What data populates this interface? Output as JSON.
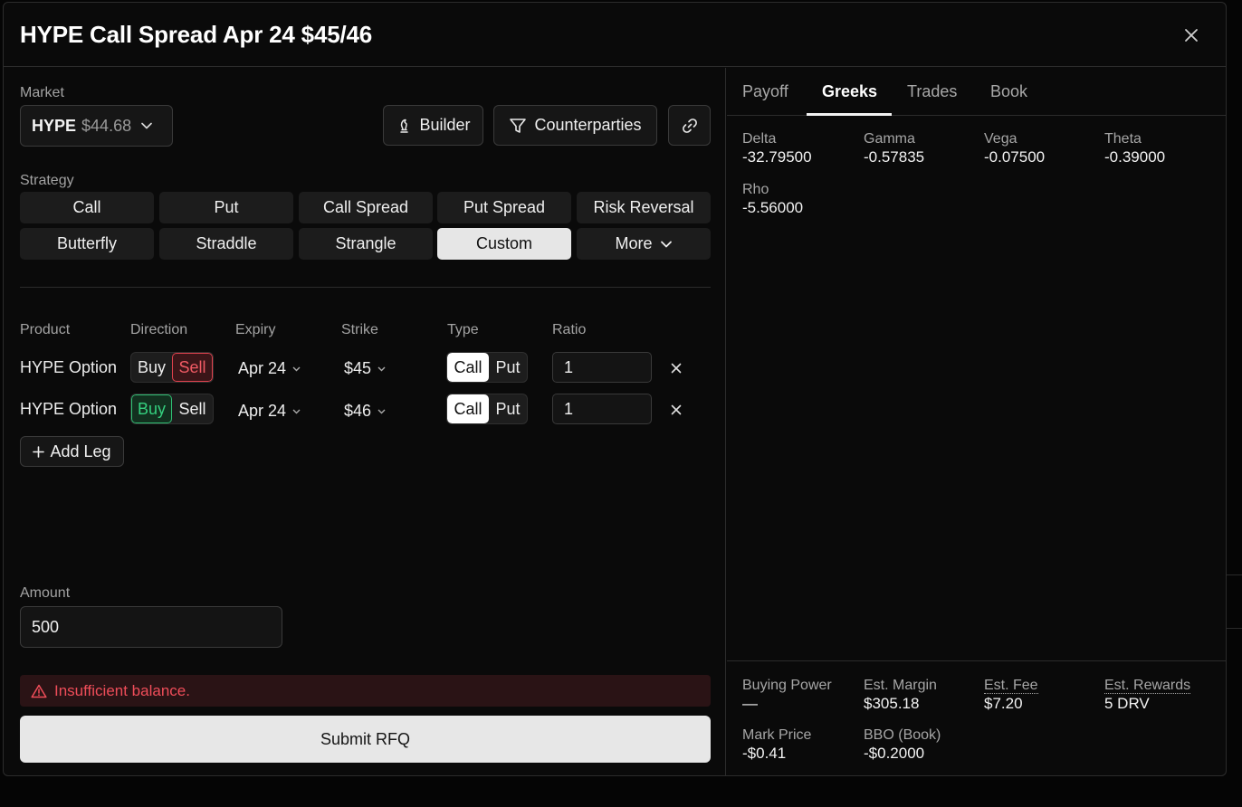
{
  "title": "HYPE Call Spread Apr 24 $45/46",
  "market": {
    "label": "Market",
    "symbol": "HYPE",
    "price": "$44.68"
  },
  "toolbar": {
    "builder": "Builder",
    "counterparties": "Counterparties"
  },
  "strategy": {
    "label": "Strategy",
    "row1": [
      "Call",
      "Put",
      "Call Spread",
      "Put Spread",
      "Risk Reversal"
    ],
    "row2": [
      "Butterfly",
      "Straddle",
      "Strangle",
      "Custom",
      "More"
    ],
    "active": "Custom"
  },
  "legs_header": {
    "product": "Product",
    "direction": "Direction",
    "expiry": "Expiry",
    "strike": "Strike",
    "type": "Type",
    "ratio": "Ratio"
  },
  "legs": [
    {
      "product": "HYPE Option",
      "buy": "Buy",
      "sell": "Sell",
      "direction": "Sell",
      "expiry": "Apr 24",
      "strike": "$45",
      "call": "Call",
      "put": "Put",
      "type": "Call",
      "ratio": "1"
    },
    {
      "product": "HYPE Option",
      "buy": "Buy",
      "sell": "Sell",
      "direction": "Buy",
      "expiry": "Apr 24",
      "strike": "$46",
      "call": "Call",
      "put": "Put",
      "type": "Call",
      "ratio": "1"
    }
  ],
  "add_leg": "Add Leg",
  "amount": {
    "label": "Amount",
    "value": "500"
  },
  "error": "Insufficient balance.",
  "submit": "Submit RFQ",
  "tabs": [
    "Payoff",
    "Greeks",
    "Trades",
    "Book"
  ],
  "active_tab": "Greeks",
  "greeks": [
    {
      "name": "Delta",
      "value": "-32.79500"
    },
    {
      "name": "Gamma",
      "value": "-0.57835"
    },
    {
      "name": "Vega",
      "value": "-0.07500"
    },
    {
      "name": "Theta",
      "value": "-0.39000"
    },
    {
      "name": "Rho",
      "value": "-5.56000"
    }
  ],
  "stats": [
    {
      "name": "Buying Power",
      "value": "—"
    },
    {
      "name": "Est. Margin",
      "value": "$305.18"
    },
    {
      "name": "Est. Fee",
      "value": "$7.20"
    },
    {
      "name": "Est. Rewards",
      "value": "5 DRV"
    },
    {
      "name": "Mark Price",
      "value": "-$0.41"
    },
    {
      "name": "BBO (Book)",
      "value": "-$0.2000"
    }
  ],
  "colors": {
    "sell": "#f05a64",
    "buy": "#35d07f",
    "background": "#0a0a0a",
    "active_button": "#e6e6e6"
  }
}
